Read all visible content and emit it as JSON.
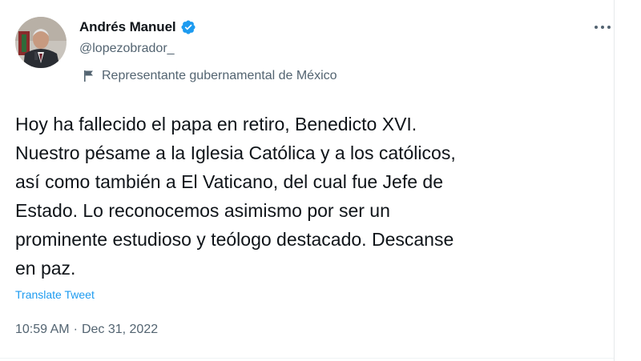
{
  "author": {
    "display_name": "Andrés Manuel",
    "handle": "@lopezobrador_",
    "verified": true,
    "avatar_icon": "profile-photo",
    "affiliation": "Representante gubernamental de México",
    "affiliation_icon": "flag-icon"
  },
  "tweet": {
    "text": "Hoy ha fallecido el papa en retiro, Benedicto XVI.\nNuestro pésame a la Iglesia Católica y a los católicos,\nasí como también a El Vaticano, del cual fue Jefe de\nEstado. Lo reconocemos asimismo por ser un\nprominente estudioso y teólogo destacado. Descanse\nen paz.",
    "translate_label": "Translate Tweet",
    "time": "10:59 AM",
    "separator": "·",
    "date": "Dec 31, 2022"
  },
  "menu": {
    "more_icon": "more-options-icon"
  },
  "colors": {
    "link": "#1d9bf0",
    "verified_badge": "#1d9bf0",
    "secondary_text": "#536471",
    "primary_text": "#0f1419"
  }
}
